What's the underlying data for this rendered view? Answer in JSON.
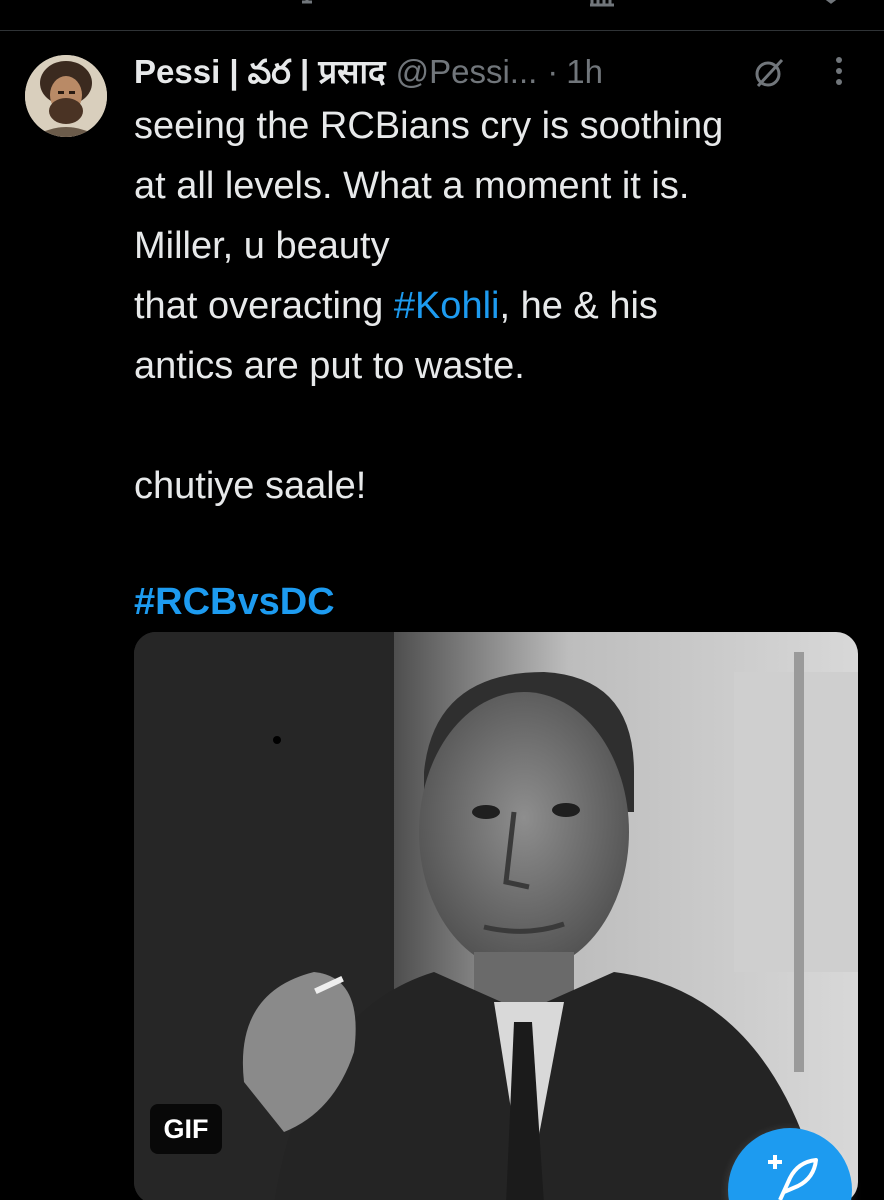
{
  "tweet": {
    "author": {
      "display_name": "Pessi | వర | प्रसाद",
      "handle": "@Pessi...",
      "separator": "·",
      "time": "1h"
    },
    "text_lines": [
      "seeing the RCBians cry is soothing",
      "at all levels. What a moment it is.",
      "Miller, u beauty"
    ],
    "line4_before": "that overacting ",
    "line4_hashtag": "#Kohli",
    "line4_after": ", he & his",
    "line5": "antics are put to waste.",
    "line6": "chutiye saale!",
    "hashtag_line": "#RCBvsDC",
    "media": {
      "type": "gif",
      "badge": "GIF"
    }
  },
  "icons": {
    "grok": "grok-icon",
    "more": "more-vertical-icon",
    "compose": "compose-feather-plus-icon",
    "avatar": "user-avatar-photo"
  },
  "colors": {
    "background": "#000000",
    "text": "#e7e9ea",
    "muted": "#71767b",
    "accent": "#1d9bf0"
  }
}
